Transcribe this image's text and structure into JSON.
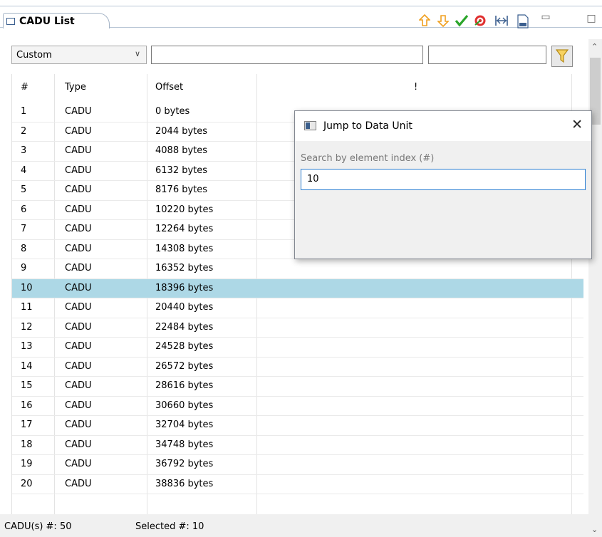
{
  "view": {
    "tab_title": "CADU List",
    "toolbar_icons": [
      "arrow-up-icon",
      "arrow-down-icon",
      "checkmark-icon",
      "target-icon",
      "expand-icon",
      "binary-file-icon",
      "minimize-icon",
      "maximize-icon"
    ]
  },
  "filters": {
    "preset_value": "Custom",
    "text_filter_value": "",
    "second_filter_value": ""
  },
  "table": {
    "columns": [
      "#",
      "Type",
      "Offset",
      "!"
    ],
    "rows": [
      [
        "1",
        "CADU",
        "0 bytes"
      ],
      [
        "2",
        "CADU",
        "2044 bytes"
      ],
      [
        "3",
        "CADU",
        "4088 bytes"
      ],
      [
        "4",
        "CADU",
        "6132 bytes"
      ],
      [
        "5",
        "CADU",
        "8176 bytes"
      ],
      [
        "6",
        "CADU",
        "10220 bytes"
      ],
      [
        "7",
        "CADU",
        "12264 bytes"
      ],
      [
        "8",
        "CADU",
        "14308 bytes"
      ],
      [
        "9",
        "CADU",
        "16352 bytes"
      ],
      [
        "10",
        "CADU",
        "18396 bytes"
      ],
      [
        "11",
        "CADU",
        "20440 bytes"
      ],
      [
        "12",
        "CADU",
        "22484 bytes"
      ],
      [
        "13",
        "CADU",
        "24528 bytes"
      ],
      [
        "14",
        "CADU",
        "26572 bytes"
      ],
      [
        "15",
        "CADU",
        "28616 bytes"
      ],
      [
        "16",
        "CADU",
        "30660 bytes"
      ],
      [
        "17",
        "CADU",
        "32704 bytes"
      ],
      [
        "18",
        "CADU",
        "34748 bytes"
      ],
      [
        "19",
        "CADU",
        "36792 bytes"
      ],
      [
        "20",
        "CADU",
        "38836 bytes"
      ]
    ],
    "selected_row": "10"
  },
  "status": {
    "count": "CADU(s) #: 50",
    "selected": "Selected #: 10"
  },
  "dialog": {
    "title": "Jump to Data Unit",
    "close_glyph": "✕",
    "label": "Search by element index (#)",
    "input_value": "10"
  },
  "colors": {
    "selection": "#add8e6",
    "arrows": "#f0a020",
    "check": "#2aa52a",
    "focus": "#2c7fd2"
  }
}
